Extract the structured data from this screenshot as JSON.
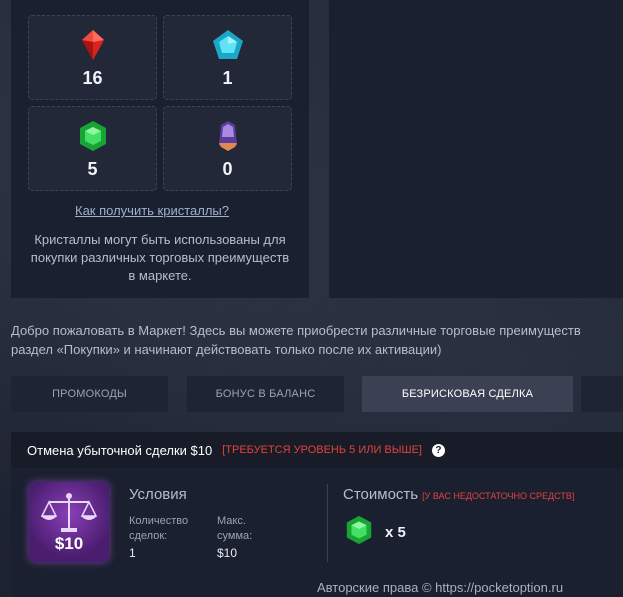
{
  "crystals": [
    {
      "name": "red",
      "count": "16",
      "icon": "red-crystal-icon",
      "color": "#e8332e"
    },
    {
      "name": "blue",
      "count": "1",
      "icon": "blue-crystal-icon",
      "color": "#34c6e0"
    },
    {
      "name": "green",
      "count": "5",
      "icon": "green-crystal-icon",
      "color": "#2ed24a"
    },
    {
      "name": "purple",
      "count": "0",
      "icon": "purple-crystal-icon",
      "color": "#9a6ad6"
    }
  ],
  "how_to_get": "Как получить кристаллы?",
  "description": "Кристаллы могут быть использованы для покупки различных торговых преимуществ в маркете.",
  "welcome_line1": "Добро пожаловать в Маркет! Здесь вы можете приобрести различные торговые преимуществ",
  "welcome_line2": "раздел «Покупки» и начинают действовать только после их активации)",
  "tabs": [
    {
      "label": "ПРОМОКОДЫ",
      "active": false
    },
    {
      "label": "БОНУС В БАЛАНС",
      "active": false
    },
    {
      "label": "БЕЗРИСКОВАЯ СДЕЛКА",
      "active": true
    }
  ],
  "offer": {
    "title": "Отмена убыточной сделки $10",
    "requirement": "[ТРЕБУЕТСЯ УРОВЕНЬ 5 ИЛИ ВЫШЕ]",
    "help": "?",
    "price_badge": "$10",
    "conditions_title": "Условия",
    "count_label_1": "Количество",
    "count_label_2": "сделок:",
    "count_value": "1",
    "max_label_1": "Макс.",
    "max_label_2": "сумма:",
    "max_value": "$10",
    "cost_title": "Стоимость",
    "cost_warning": "[У ВАС НЕДОСТАТОЧНО СРЕДСТВ]",
    "cost_multiplier": "x 5",
    "cost_icon": "green-crystal-icon"
  },
  "copyright": "Авторские права © https://pocketoption.ru"
}
